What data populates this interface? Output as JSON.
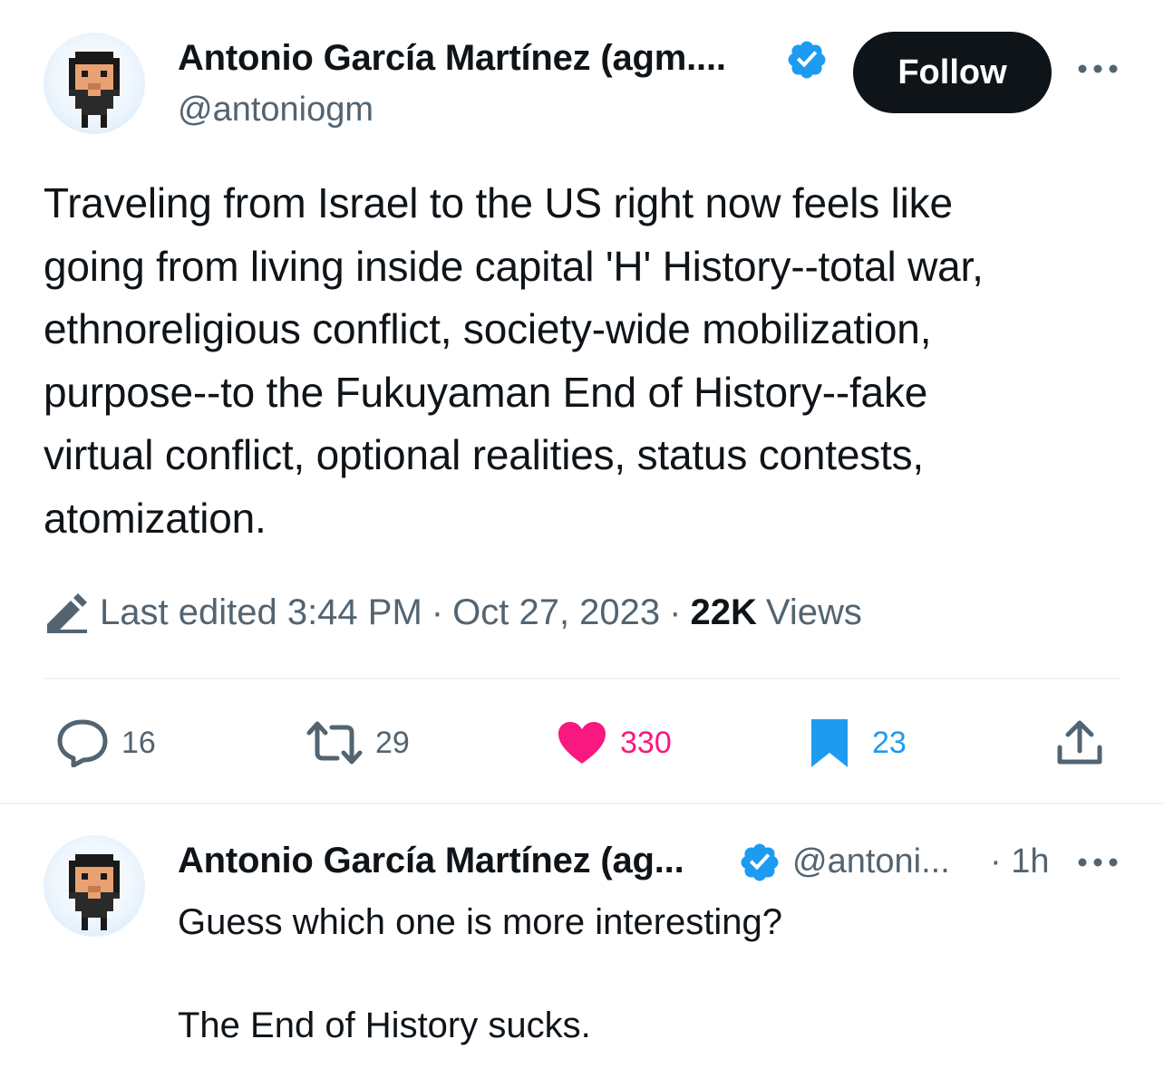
{
  "colors": {
    "text": "#0f1419",
    "muted": "#536471",
    "verified": "#1d9bf0",
    "like": "#f91880",
    "bookmark": "#1d9bf0",
    "follow_bg": "#0f1419"
  },
  "tweet": {
    "display_name": "Antonio García Martínez (agm....",
    "handle": "@antoniogm",
    "follow_label": "Follow",
    "text": "Traveling from Israel to the US right now feels like\ngoing from living inside capital 'H' History--total war,\nethnoreligious conflict, society-wide mobilization,\npurpose--to the Fukuyaman End of History--fake\nvirtual conflict, optional realities, status contests,\natomization.",
    "edited_label": "Last edited 3:44 PM",
    "separator": "·",
    "date": "Oct 27, 2023",
    "views_count": "22K",
    "views_label": "Views",
    "icons": {
      "verified": "verified-badge-icon",
      "more": "more-dots-icon",
      "edit": "pencil-edit-icon"
    }
  },
  "actions": {
    "replies": "16",
    "reposts": "29",
    "likes": "330",
    "bookmarks": "23"
  },
  "reply": {
    "display_name": "Antonio García Martínez (ag...",
    "handle": "@antoni...",
    "time": "· 1h",
    "text": "Guess which one is more interesting?\n\nThe End of History sucks."
  }
}
